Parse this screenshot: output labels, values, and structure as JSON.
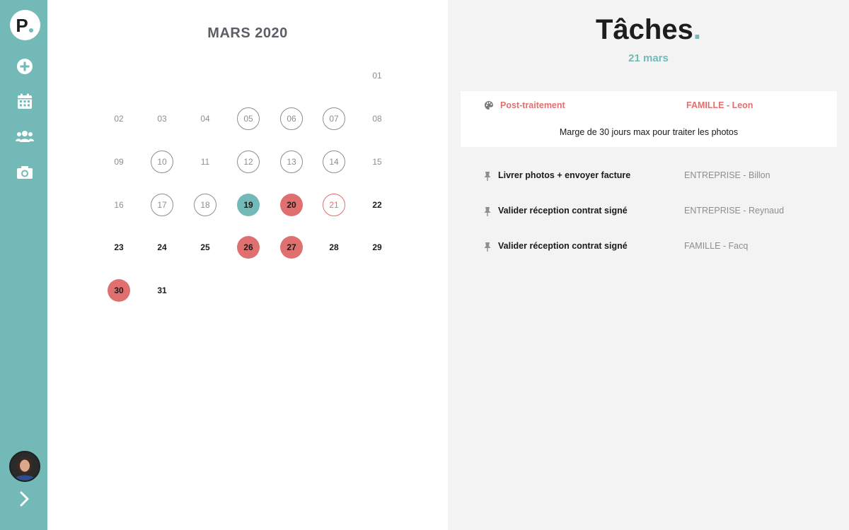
{
  "sidebar": {
    "logo_letter": "P",
    "icons": [
      "plus-circle-icon",
      "calendar-icon",
      "users-icon",
      "camera-icon"
    ],
    "expand_icon": "chevron-right-icon",
    "accent_color": "#72b9b7"
  },
  "calendar": {
    "month_title": "MARS 2020",
    "days": [
      {
        "label": "01",
        "style": "plain"
      },
      {
        "label": "02",
        "style": "plain"
      },
      {
        "label": "03",
        "style": "plain"
      },
      {
        "label": "04",
        "style": "plain"
      },
      {
        "label": "05",
        "style": "outline"
      },
      {
        "label": "06",
        "style": "outline"
      },
      {
        "label": "07",
        "style": "outline"
      },
      {
        "label": "08",
        "style": "plain"
      },
      {
        "label": "09",
        "style": "plain"
      },
      {
        "label": "10",
        "style": "outline"
      },
      {
        "label": "11",
        "style": "plain"
      },
      {
        "label": "12",
        "style": "outline"
      },
      {
        "label": "13",
        "style": "outline"
      },
      {
        "label": "14",
        "style": "outline"
      },
      {
        "label": "15",
        "style": "plain"
      },
      {
        "label": "16",
        "style": "plain"
      },
      {
        "label": "17",
        "style": "outline"
      },
      {
        "label": "18",
        "style": "outline"
      },
      {
        "label": "19",
        "style": "teal"
      },
      {
        "label": "20",
        "style": "red"
      },
      {
        "label": "21",
        "style": "red-outline"
      },
      {
        "label": "22",
        "style": "bold"
      },
      {
        "label": "23",
        "style": "bold"
      },
      {
        "label": "24",
        "style": "bold"
      },
      {
        "label": "25",
        "style": "bold"
      },
      {
        "label": "26",
        "style": "red"
      },
      {
        "label": "27",
        "style": "red"
      },
      {
        "label": "28",
        "style": "bold"
      },
      {
        "label": "29",
        "style": "bold"
      },
      {
        "label": "30",
        "style": "red"
      },
      {
        "label": "31",
        "style": "bold"
      }
    ],
    "colors": {
      "selected": "#72b9b7",
      "busy": "#e07070",
      "muted": "#8e8e8e"
    }
  },
  "tasks": {
    "title": "Tâches",
    "title_dot": ".",
    "date": "21 mars",
    "highlight": {
      "icon": "palette-icon",
      "title": "Post-traitement",
      "client": "FAMILLE - Leon",
      "description": "Marge de 30 jours max pour traiter les photos"
    },
    "items": [
      {
        "icon": "pin-icon",
        "title": "Livrer photos + envoyer facture",
        "client": "ENTREPRISE - Billon"
      },
      {
        "icon": "pin-icon",
        "title": "Valider réception contrat signé",
        "client": "ENTREPRISE - Reynaud"
      },
      {
        "icon": "pin-icon",
        "title": "Valider réception contrat signé",
        "client": "FAMILLE - Facq"
      }
    ]
  }
}
